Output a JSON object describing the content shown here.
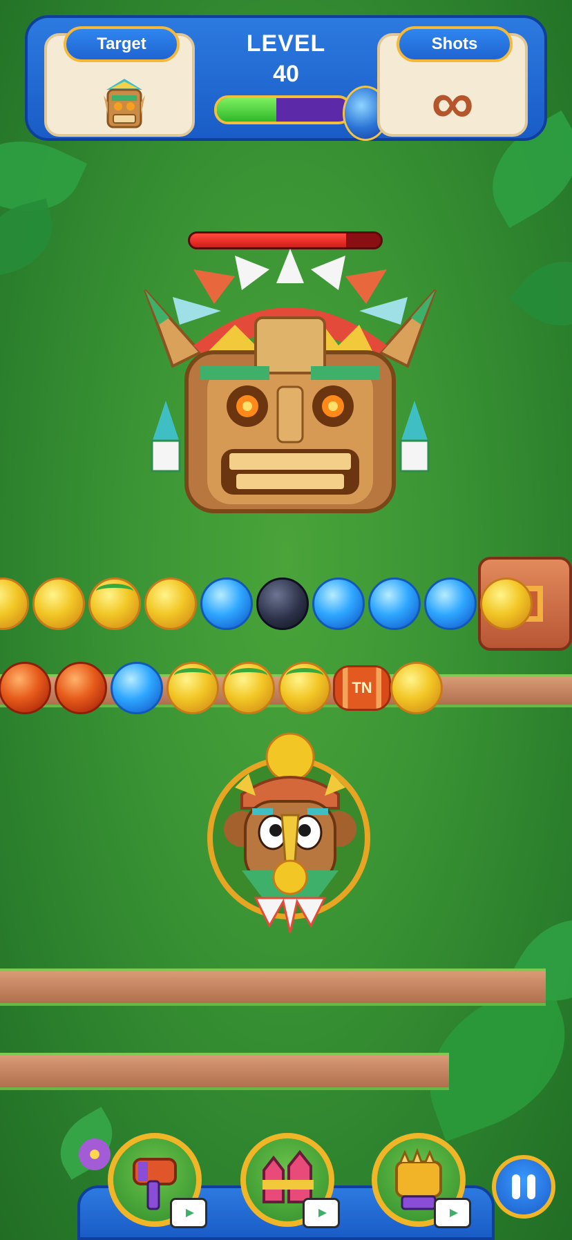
{
  "hud": {
    "target_label": "Target",
    "level_label": "LEVEL",
    "level_number": "40",
    "shots_label": "Shots",
    "shots_value": "∞",
    "level_progress": 0.45
  },
  "boss": {
    "health": 0.82
  },
  "rows": [
    {
      "balls": [
        "yellow",
        "yellow",
        "yellow-vine",
        "yellow",
        "blue",
        "black",
        "blue",
        "blue",
        "blue",
        "yellow"
      ]
    },
    {
      "balls": [
        "red",
        "red",
        "blue",
        "yellow-vine",
        "yellow-vine",
        "yellow-vine",
        "tnt",
        "yellow"
      ]
    }
  ],
  "tnt_label": "TN",
  "shooter": {
    "loaded_ball": "yellow",
    "next_ball": "yellow"
  },
  "boosters": [
    {
      "name": "hammer-icon"
    },
    {
      "name": "rockets-icon"
    },
    {
      "name": "spiked-block-icon"
    }
  ],
  "pause_icon": "pause-icon",
  "colors": {
    "hud_blue": "#1f66d4",
    "gold": "#f0b628",
    "grass": "#3a9434"
  }
}
